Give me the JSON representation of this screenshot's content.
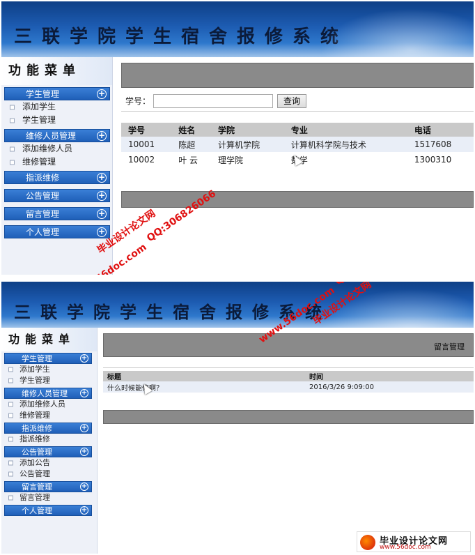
{
  "app_title": "三联学院学生宿舍报修系统",
  "shot1": {
    "menu_title": "功能菜单",
    "groups": [
      {
        "label": "学生管理",
        "items": [
          "添加学生",
          "学生管理"
        ]
      },
      {
        "label": "维修人员管理",
        "items": [
          "添加维修人员",
          "维修管理"
        ]
      },
      {
        "label": "指派维修",
        "items": []
      },
      {
        "label": "公告管理",
        "items": []
      },
      {
        "label": "留言管理",
        "items": []
      },
      {
        "label": "个人管理",
        "items": []
      }
    ],
    "search": {
      "label": "学号：",
      "value": "",
      "button": "查询"
    },
    "table": {
      "headers": [
        "学号",
        "姓名",
        "学院",
        "专业",
        "电话"
      ],
      "rows": [
        [
          "10001",
          "陈超",
          "计算机学院",
          "计算机科学院与技术",
          "1517608"
        ],
        [
          "10002",
          "叶 云",
          "理学院",
          "数学",
          "1300310"
        ]
      ]
    }
  },
  "shot2": {
    "menu_title": "功能菜单",
    "groups": [
      {
        "label": "学生管理",
        "items": [
          "添加学生",
          "学生管理"
        ]
      },
      {
        "label": "维修人员管理",
        "items": [
          "添加维修人员",
          "维修管理"
        ]
      },
      {
        "label": "指派维修",
        "items": [
          "指派维修"
        ]
      },
      {
        "label": "公告管理",
        "items": [
          "添加公告",
          "公告管理"
        ]
      },
      {
        "label": "留言管理",
        "items": [
          "留言管理"
        ]
      },
      {
        "label": "个人管理",
        "items": []
      }
    ],
    "page_title": "留言管理",
    "table": {
      "headers": [
        "标题",
        "时间"
      ],
      "rows": [
        [
          "什么时候能修啊？",
          "2016/3/26 9:09:00"
        ]
      ]
    }
  },
  "watermarks": {
    "site": "www.56doc.com",
    "qq": "QQ:306826066",
    "brand": "毕业设计论文网"
  },
  "footer_logo": {
    "title": "毕业设计论文网",
    "url": "www.56doc.com"
  },
  "icons": [
    "plus-circle-icon",
    "list-item-icon",
    "mouse-cursor-icon"
  ],
  "colors": {
    "banner": "#1d5cb2",
    "menu_group": "#2f70c8",
    "watermark": "#e01010"
  }
}
